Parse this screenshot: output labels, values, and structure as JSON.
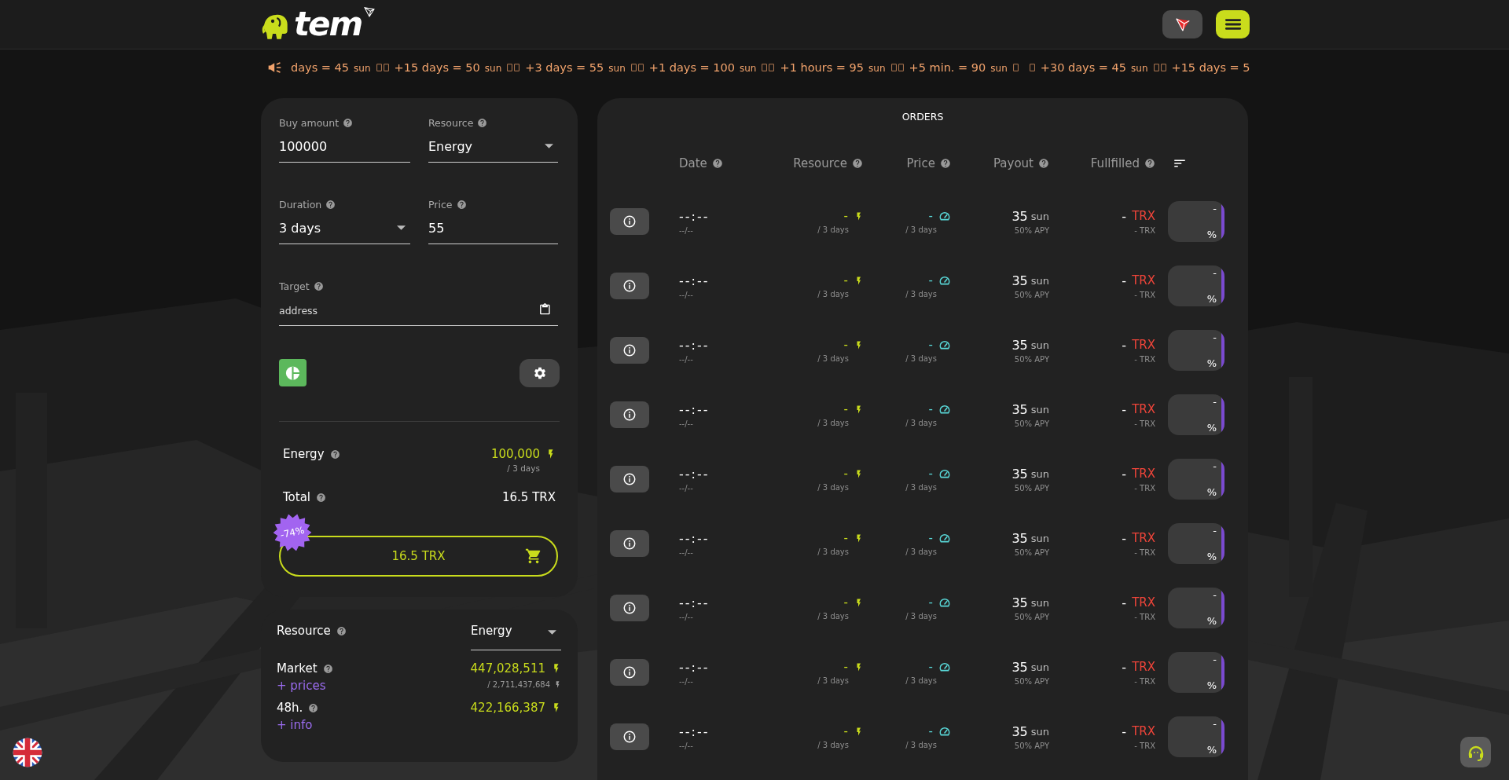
{
  "header": {
    "logo_text": "tem"
  },
  "ticker": {
    "groups": [
      [
        {
          "text": "days = 45",
          "unit": "sun"
        },
        {
          "text": "+15 days = 50",
          "unit": "sun"
        },
        {
          "text": "+3 days = 55",
          "unit": "sun"
        },
        {
          "text": "+1 days = 100",
          "unit": "sun"
        },
        {
          "text": "+1 hours = 95",
          "unit": "sun"
        },
        {
          "text": "+5 min. = 90",
          "unit": "sun"
        }
      ],
      [
        {
          "text": "+30 days = 45",
          "unit": "sun"
        },
        {
          "text": "+15 days = 5"
        }
      ]
    ]
  },
  "form": {
    "fields": [
      {
        "kind": "input",
        "label": "Buy amount",
        "value": "100000"
      },
      {
        "kind": "select",
        "label": "Resource",
        "value": "Energy"
      },
      {
        "kind": "select",
        "label": "Duration",
        "value": "3 days"
      },
      {
        "kind": "input",
        "label": "Price",
        "value": "55"
      },
      {
        "kind": "address",
        "label": "Target",
        "placeholder": "address"
      }
    ],
    "summary": [
      {
        "kind": "resource",
        "label": "Energy",
        "value": "100,000",
        "sub": "/ 3 days"
      },
      {
        "kind": "total",
        "label": "Total",
        "value": "16.5 TRX"
      }
    ],
    "buy_button": {
      "label": "16.5 TRX",
      "badge": "-74%"
    }
  },
  "market": {
    "resource": {
      "label": "Resource",
      "value": "Energy"
    },
    "rows": [
      {
        "label": "Market",
        "link": "+ prices",
        "value": "447,028,511",
        "sub": "/ 2,711,437,684"
      },
      {
        "label": "48h.",
        "link": "+ info",
        "value": "422,166,387"
      }
    ]
  },
  "orders": {
    "title": "ORDERS",
    "columns": [
      {
        "label": "Date"
      },
      {
        "label": "Resource"
      },
      {
        "label": "Price"
      },
      {
        "label": "Payout"
      },
      {
        "label": "Fullfilled"
      }
    ],
    "rows": [
      {
        "time": "--:--",
        "date": "--/--",
        "resource": "-",
        "resource_sub": "/ 3 days",
        "price": "-",
        "price_sub": "/ 3 days",
        "payout": "35",
        "payout_unit": "sun",
        "apy": "50% APY",
        "fulfilled": "-",
        "fulfilled_unit": "TRX",
        "fulfilled_sub": "- TRX",
        "progress": "-",
        "progress_unit": "%"
      },
      {
        "time": "--:--",
        "date": "--/--",
        "resource": "-",
        "resource_sub": "/ 3 days",
        "price": "-",
        "price_sub": "/ 3 days",
        "payout": "35",
        "payout_unit": "sun",
        "apy": "50% APY",
        "fulfilled": "-",
        "fulfilled_unit": "TRX",
        "fulfilled_sub": "- TRX",
        "progress": "-",
        "progress_unit": "%"
      },
      {
        "time": "--:--",
        "date": "--/--",
        "resource": "-",
        "resource_sub": "/ 3 days",
        "price": "-",
        "price_sub": "/ 3 days",
        "payout": "35",
        "payout_unit": "sun",
        "apy": "50% APY",
        "fulfilled": "-",
        "fulfilled_unit": "TRX",
        "fulfilled_sub": "- TRX",
        "progress": "-",
        "progress_unit": "%"
      },
      {
        "time": "--:--",
        "date": "--/--",
        "resource": "-",
        "resource_sub": "/ 3 days",
        "price": "-",
        "price_sub": "/ 3 days",
        "payout": "35",
        "payout_unit": "sun",
        "apy": "50% APY",
        "fulfilled": "-",
        "fulfilled_unit": "TRX",
        "fulfilled_sub": "- TRX",
        "progress": "-",
        "progress_unit": "%"
      },
      {
        "time": "--:--",
        "date": "--/--",
        "resource": "-",
        "resource_sub": "/ 3 days",
        "price": "-",
        "price_sub": "/ 3 days",
        "payout": "35",
        "payout_unit": "sun",
        "apy": "50% APY",
        "fulfilled": "-",
        "fulfilled_unit": "TRX",
        "fulfilled_sub": "- TRX",
        "progress": "-",
        "progress_unit": "%"
      },
      {
        "time": "--:--",
        "date": "--/--",
        "resource": "-",
        "resource_sub": "/ 3 days",
        "price": "-",
        "price_sub": "/ 3 days",
        "payout": "35",
        "payout_unit": "sun",
        "apy": "50% APY",
        "fulfilled": "-",
        "fulfilled_unit": "TRX",
        "fulfilled_sub": "- TRX",
        "progress": "-",
        "progress_unit": "%"
      },
      {
        "time": "--:--",
        "date": "--/--",
        "resource": "-",
        "resource_sub": "/ 3 days",
        "price": "-",
        "price_sub": "/ 3 days",
        "payout": "35",
        "payout_unit": "sun",
        "apy": "50% APY",
        "fulfilled": "-",
        "fulfilled_unit": "TRX",
        "fulfilled_sub": "- TRX",
        "progress": "-",
        "progress_unit": "%"
      },
      {
        "time": "--:--",
        "date": "--/--",
        "resource": "-",
        "resource_sub": "/ 3 days",
        "price": "-",
        "price_sub": "/ 3 days",
        "payout": "35",
        "payout_unit": "sun",
        "apy": "50% APY",
        "fulfilled": "-",
        "fulfilled_unit": "TRX",
        "fulfilled_sub": "- TRX",
        "progress": "-",
        "progress_unit": "%"
      },
      {
        "time": "--:--",
        "date": "--/--",
        "resource": "-",
        "resource_sub": "/ 3 days",
        "price": "-",
        "price_sub": "/ 3 days",
        "payout": "35",
        "payout_unit": "sun",
        "apy": "50% APY",
        "fulfilled": "-",
        "fulfilled_unit": "TRX",
        "fulfilled_sub": "- TRX",
        "progress": "-",
        "progress_unit": "%"
      }
    ]
  }
}
